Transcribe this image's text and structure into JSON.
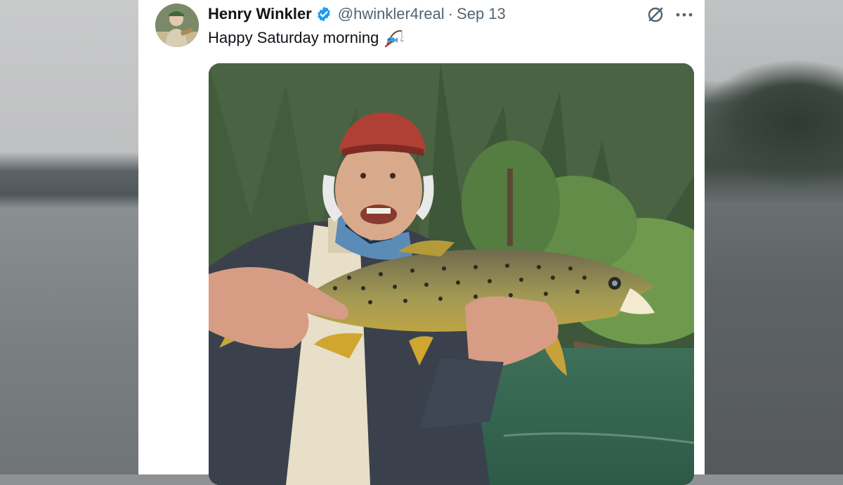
{
  "tweet": {
    "author_name": "Henry Winkler",
    "handle": "@hwinkler4real",
    "separator": "·",
    "date": "Sep 13",
    "text": "Happy Saturday morning"
  },
  "icons": {
    "verified": "verified-badge-icon",
    "grok": "grok-icon",
    "more": "more-options-icon",
    "emoji": "fishing-pole-emoji"
  },
  "colors": {
    "verified_blue": "#1d9bf0",
    "text_primary": "#0f1419",
    "text_secondary": "#536471"
  }
}
